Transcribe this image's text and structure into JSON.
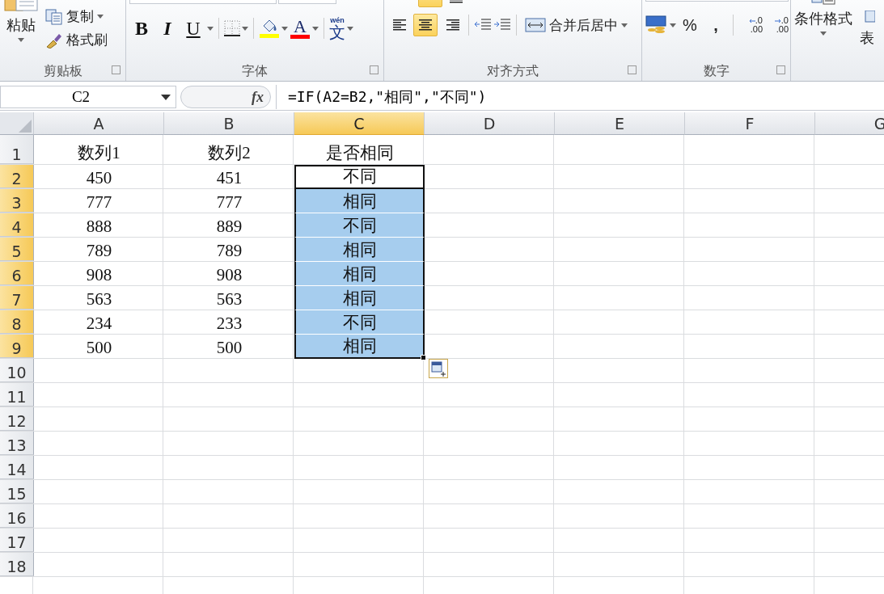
{
  "ribbon": {
    "clipboard": {
      "label": "剪贴板",
      "paste_label": "粘贴",
      "copy_label": "复制",
      "format_painter_label": "格式刷"
    },
    "font": {
      "label": "字体",
      "style_buttons": [
        {
          "kind": "bold",
          "glyph": "B"
        },
        {
          "kind": "italic",
          "glyph": "I"
        },
        {
          "kind": "underline",
          "glyph": "U"
        }
      ],
      "font_color_glyph": "A",
      "phonetic_pinyin": "wén",
      "phonetic_glyph": "文"
    },
    "alignment": {
      "label": "对齐方式",
      "top_buttons": [
        {
          "kind": "middle",
          "selected": true
        },
        {
          "kind": "bottom",
          "selected": false
        }
      ],
      "buttons": [
        {
          "kind": "left",
          "selected": false
        },
        {
          "kind": "center",
          "selected": true
        },
        {
          "kind": "right",
          "selected": false
        }
      ],
      "merge_label": "合并后居中"
    },
    "number": {
      "label": "数字",
      "percent_glyph": "%",
      "comma_glyph": ",",
      "decimal_buttons": [
        {
          "kind": "increase",
          "top": ".0",
          "bottom": ".00"
        },
        {
          "kind": "decrease",
          "top": ".0",
          "bottom": ".00"
        }
      ]
    },
    "styles": {
      "conditional_format_label": "条件格式",
      "table_label": "表"
    }
  },
  "formula_bar": {
    "name_box": "C2",
    "function_glyph": "fx",
    "formula": "=IF(A2=B2,\"相同\",\"不同\")"
  },
  "sheet": {
    "columns": [
      {
        "label": "A",
        "selected": false
      },
      {
        "label": "B",
        "selected": false
      },
      {
        "label": "C",
        "selected": true
      },
      {
        "label": "D",
        "selected": false
      },
      {
        "label": "E",
        "selected": false
      },
      {
        "label": "F",
        "selected": false
      },
      {
        "label": "G",
        "selected": false
      }
    ],
    "rows": [
      {
        "label": "1",
        "selected": false,
        "cells": [
          "数列1",
          "数列2",
          "是否相同"
        ]
      },
      {
        "label": "2",
        "selected": true,
        "active": true,
        "cells": [
          "450",
          "451",
          "不同"
        ]
      },
      {
        "label": "3",
        "selected": true,
        "active": false,
        "cells": [
          "777",
          "777",
          "相同"
        ]
      },
      {
        "label": "4",
        "selected": true,
        "active": false,
        "cells": [
          "888",
          "889",
          "不同"
        ]
      },
      {
        "label": "5",
        "selected": true,
        "active": false,
        "cells": [
          "789",
          "789",
          "相同"
        ]
      },
      {
        "label": "6",
        "selected": true,
        "active": false,
        "cells": [
          "908",
          "908",
          "相同"
        ]
      },
      {
        "label": "7",
        "selected": true,
        "active": false,
        "cells": [
          "563",
          "563",
          "相同"
        ]
      },
      {
        "label": "8",
        "selected": true,
        "active": false,
        "cells": [
          "234",
          "233",
          "不同"
        ]
      },
      {
        "label": "9",
        "selected": true,
        "active": false,
        "cells": [
          "500",
          "500",
          "相同"
        ]
      },
      {
        "label": "10",
        "selected": false
      },
      {
        "label": "11",
        "selected": false
      },
      {
        "label": "12",
        "selected": false
      },
      {
        "label": "13",
        "selected": false
      },
      {
        "label": "14",
        "selected": false
      },
      {
        "label": "15",
        "selected": false
      },
      {
        "label": "16",
        "selected": false
      },
      {
        "label": "17",
        "selected": false
      },
      {
        "label": "18",
        "selected": false
      }
    ]
  }
}
